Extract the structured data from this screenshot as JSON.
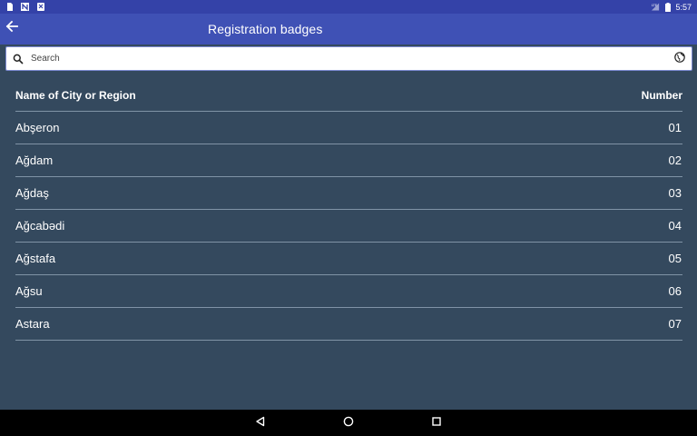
{
  "status_bar": {
    "left_icons": [
      "storage-icon",
      "n-notification-icon",
      "download-notification-icon"
    ],
    "right_icons": [
      "lte-signal-icon",
      "battery-icon"
    ],
    "time": "5:57"
  },
  "app_bar": {
    "back_icon": "arrow-back-icon",
    "title": "Registration badges"
  },
  "search": {
    "placeholder": "Search",
    "value": "",
    "leading_icon": "search-icon",
    "trailing_icon": "globe-icon"
  },
  "table": {
    "headers": {
      "name": "Name of City or Region",
      "number": "Number"
    },
    "rows": [
      {
        "name": "Abşeron",
        "number": "01"
      },
      {
        "name": "Ağdam",
        "number": "02"
      },
      {
        "name": "Ağdaş",
        "number": "03"
      },
      {
        "name": "Ağcabədi",
        "number": "04"
      },
      {
        "name": "Ağstafa",
        "number": "05"
      },
      {
        "name": "Ağsu",
        "number": "06"
      },
      {
        "name": "Astara",
        "number": "07"
      }
    ]
  },
  "nav_bar": {
    "buttons": [
      "back-triangle-icon",
      "home-circle-icon",
      "recents-square-icon"
    ]
  },
  "colors": {
    "status_bar": "#3442a8",
    "app_bar": "#3f51b5",
    "background": "#34495e",
    "divider": "#8093a6",
    "text": "#ffffff",
    "nav_bar": "#000000"
  }
}
